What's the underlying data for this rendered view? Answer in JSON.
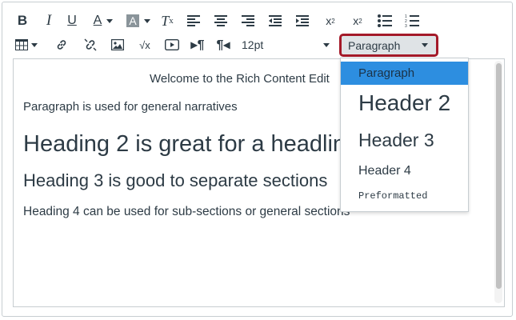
{
  "toolbar": {
    "row1": [
      {
        "name": "bold-icon",
        "glyph": "B"
      },
      {
        "name": "italic-icon",
        "glyph": "I"
      },
      {
        "name": "underline-icon",
        "glyph": "U"
      },
      {
        "name": "text-color-icon",
        "glyph": "A"
      },
      {
        "name": "background-color-icon",
        "glyph": "A"
      },
      {
        "name": "clear-formatting-icon",
        "glyph": "T"
      },
      {
        "name": "align-left-icon"
      },
      {
        "name": "align-center-icon"
      },
      {
        "name": "align-right-icon"
      },
      {
        "name": "outdent-icon"
      },
      {
        "name": "indent-icon"
      },
      {
        "name": "superscript-icon",
        "glyph": "x²"
      },
      {
        "name": "subscript-icon",
        "glyph": "x₂"
      },
      {
        "name": "bullet-list-icon"
      },
      {
        "name": "numbered-list-icon"
      }
    ],
    "row2": [
      {
        "name": "table-icon"
      },
      {
        "name": "link-icon"
      },
      {
        "name": "unlink-icon"
      },
      {
        "name": "image-icon"
      },
      {
        "name": "math-equation-icon",
        "glyph": "√x"
      },
      {
        "name": "media-icon"
      },
      {
        "name": "ltr-paragraph-icon",
        "glyph": "¶"
      },
      {
        "name": "rtl-paragraph-icon",
        "glyph": "¶"
      }
    ],
    "font_size_value": "12pt",
    "format_value": "Paragraph"
  },
  "editor": {
    "welcome": "Welcome to the Rich Content Edit",
    "paragraph": "Paragraph is used for general narratives",
    "heading2": "Heading 2 is great for a headline",
    "heading3": "Heading 3 is good to separate sections",
    "heading4": "Heading 4 can be used for sub-sections or general sections"
  },
  "format_dropdown": {
    "options": [
      "Paragraph",
      "Header 2",
      "Header 3",
      "Header 4",
      "Preformatted"
    ],
    "selected": "Paragraph"
  },
  "colors": {
    "accent_outline": "#a41a29",
    "highlight": "#2d8ee0",
    "text": "#2d3b45"
  }
}
